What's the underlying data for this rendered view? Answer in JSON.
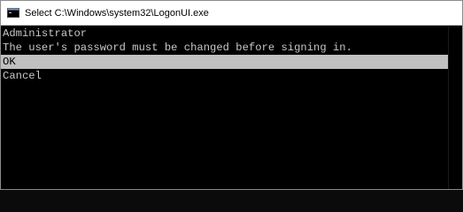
{
  "window": {
    "title": "Select C:\\Windows\\system32\\LogonUI.exe",
    "icon": "console-window-icon"
  },
  "console": {
    "username": "Administrator",
    "message": "The user's password must be changed before signing in.",
    "options": [
      {
        "label": "OK",
        "selected": true
      },
      {
        "label": "Cancel",
        "selected": false
      }
    ]
  },
  "colors": {
    "console_background": "#000000",
    "console_text": "#c8c8c8",
    "selection_background": "#c0c0c0",
    "titlebar_background": "#ffffff"
  }
}
